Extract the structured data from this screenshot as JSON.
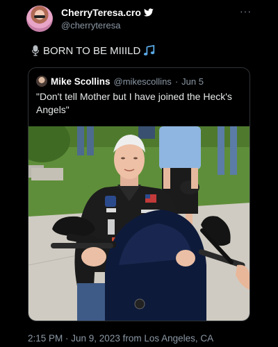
{
  "author": {
    "display_name": "CherryTeresa.cro",
    "handle": "@cherryteresa",
    "verified_icon": "twitter-bird-icon"
  },
  "more_icon": "more-horizontal-icon",
  "more_label": "···",
  "tweet": {
    "text": "BORN TO BE MIIILD",
    "prefix_icon": "microphone-emoji",
    "suffix_icon": "musical-notes-emoji"
  },
  "quote": {
    "name": "Mike Scollins",
    "handle": "@mikescollins",
    "separator": "·",
    "date": "Jun 5",
    "text": "\"Don't tell Mother but I have joined the Heck's Angels\""
  },
  "footer": {
    "timestamp": "2:15 PM · Jun 9, 2023 from Los Angeles, CA"
  },
  "colors": {
    "background": "#000000",
    "text": "#e7e9ea",
    "muted": "#8b98a5",
    "border": "#2f3336",
    "accent": "#1d9bf0"
  }
}
